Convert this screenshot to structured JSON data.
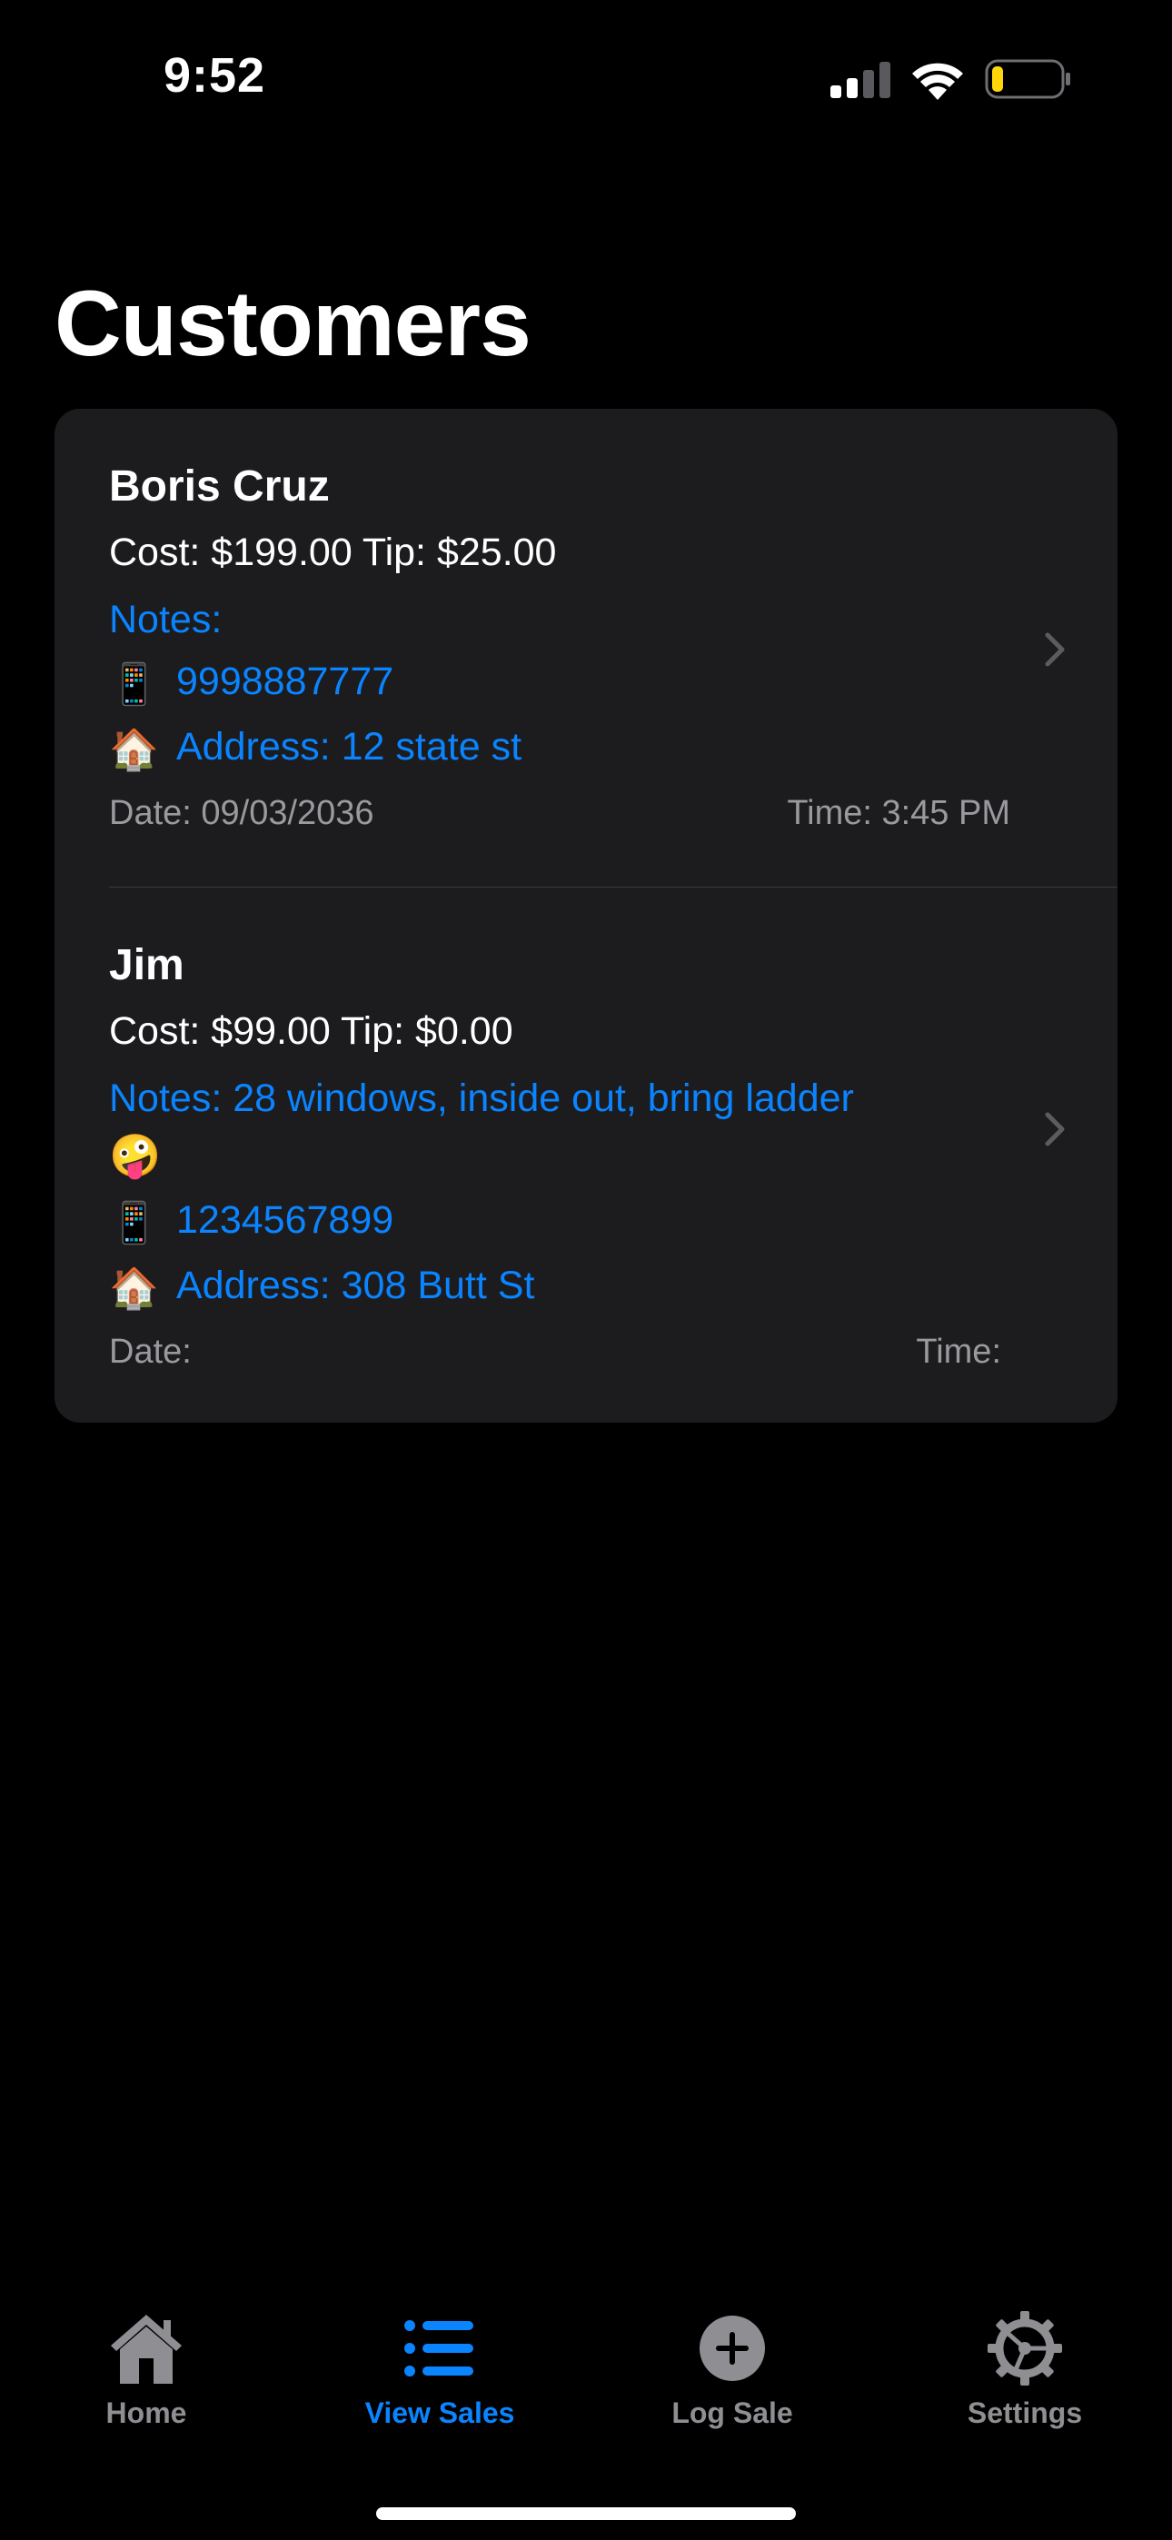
{
  "status_bar": {
    "time": "9:52",
    "icons": [
      "signal-icon",
      "wifi-icon",
      "battery-icon"
    ],
    "battery_color": "#ffd60a"
  },
  "page": {
    "title": "Customers"
  },
  "customers": [
    {
      "name": "Boris Cruz",
      "cost_tip": "Cost: $199.00  Tip: $25.00",
      "notes_line1": "Notes:",
      "notes_line2": "",
      "phone_emoji": "📱",
      "phone": "9998887777",
      "address_emoji": "🏠",
      "address": "Address: 12 state st",
      "date": "Date: 09/03/2036",
      "time": "Time: 3:45 PM"
    },
    {
      "name": "Jim",
      "cost_tip": "Cost: $99.00  Tip: $0.00",
      "notes_line1": "Notes: 28 windows, inside out, bring ladder",
      "notes_line2": "🤪",
      "phone_emoji": "📱",
      "phone": "1234567899",
      "address_emoji": "🏠",
      "address": "Address: 308 Butt St",
      "date": "Date:",
      "time": "Time:"
    }
  ],
  "tab_bar": {
    "tabs": [
      {
        "label": "Home",
        "icon": "house-icon",
        "active": false
      },
      {
        "label": "View Sales",
        "icon": "list-icon",
        "active": true
      },
      {
        "label": "Log Sale",
        "icon": "plus-circle-icon",
        "active": false
      },
      {
        "label": "Settings",
        "icon": "gear-icon",
        "active": false
      }
    ]
  },
  "colors": {
    "accent": "#0a84ff",
    "background": "#000000",
    "card": "#1c1c1e",
    "secondary_text": "#9a9a9e",
    "inactive_tab": "#8e8e93"
  }
}
